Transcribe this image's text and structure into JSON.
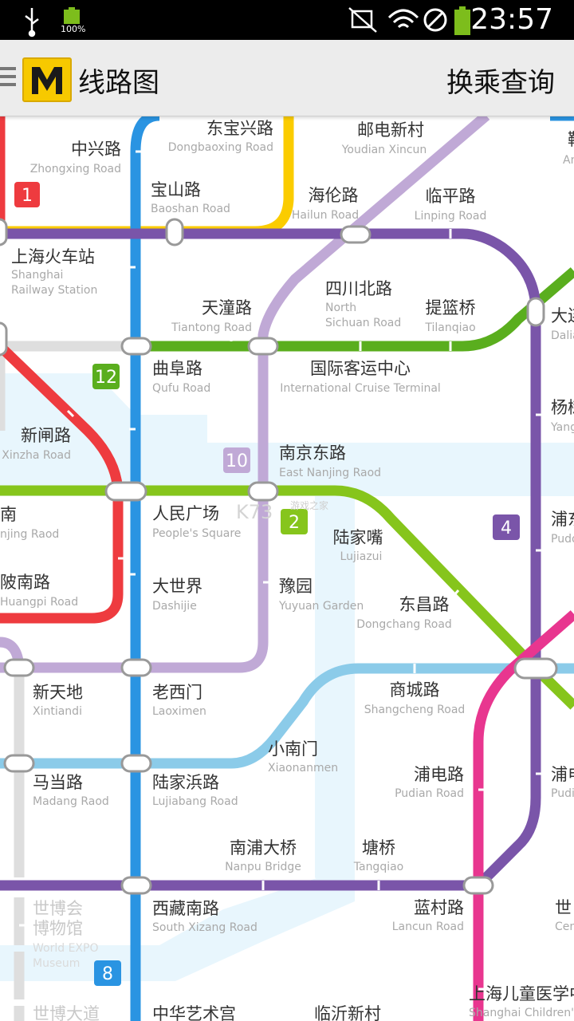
{
  "status_bar": {
    "battery": "100%",
    "time": "23:57"
  },
  "app_bar": {
    "title": "线路图",
    "transfer_action": "换乘查询"
  },
  "watermark": {
    "text": "K73",
    "sub": "游戏之家"
  },
  "map": {
    "line_colors": {
      "line1": "#ee3b3f",
      "line2": "#86c51c",
      "line3": "#fbcc00",
      "line4": "#7a55a9",
      "line8": "#2a94e2",
      "line9": "#8bcbe9",
      "line10": "#c0a9d6",
      "line12": "#5aae1e",
      "line13": "#e8368f",
      "line_gray": "#dedede",
      "river": "#e8f6fd"
    },
    "line_badges": [
      {
        "id": "1",
        "label": "1",
        "color": "#ee3b3f"
      },
      {
        "id": "12",
        "label": "12",
        "color": "#5aae1e"
      },
      {
        "id": "10",
        "label": "10",
        "color": "#c0a9d6"
      },
      {
        "id": "2",
        "label": "2",
        "color": "#86c51c"
      },
      {
        "id": "4",
        "label": "4",
        "color": "#7a55a9"
      },
      {
        "id": "8",
        "label": "8",
        "color": "#2a94e2"
      }
    ],
    "stations": [
      {
        "id": "zhongxing",
        "zh": "中兴路",
        "en": "Zhongxing Road"
      },
      {
        "id": "dongbaoxing",
        "zh": "东宝兴路",
        "en": "Dongbaoxing Road"
      },
      {
        "id": "youdian",
        "zh": "邮电新村",
        "en": "Youdian Xincun"
      },
      {
        "id": "baoshan",
        "zh": "宝山路",
        "en": "Baoshan Road"
      },
      {
        "id": "hailun",
        "zh": "海伦路",
        "en": "Hailun Road"
      },
      {
        "id": "linping",
        "zh": "临平路",
        "en": "Linping Road"
      },
      {
        "id": "shanghai_rs",
        "zh": "上海火车站",
        "en": "Shanghai",
        "en2": "Railway Station"
      },
      {
        "id": "sichuanbei",
        "zh": "四川北路",
        "en": "North",
        "en2": "Sichuan Road"
      },
      {
        "id": "tiantong",
        "zh": "天潼路",
        "en": "Tiantong Road"
      },
      {
        "id": "tilanqiao",
        "zh": "提篮桥",
        "en": "Tilanqiao"
      },
      {
        "id": "dalian",
        "zh": "大连",
        "en": "Dalia"
      },
      {
        "id": "qufu",
        "zh": "曲阜路",
        "en": "Qufu Road"
      },
      {
        "id": "cruise",
        "zh": "国际客运中心",
        "en": "International Cruise Terminal"
      },
      {
        "id": "yang",
        "zh": "杨树",
        "en": "Yang"
      },
      {
        "id": "xinzha",
        "zh": "新闸路",
        "en": "Xinzha Road"
      },
      {
        "id": "nanjingdong",
        "zh": "南京东路",
        "en": "East Nanjing Raod"
      },
      {
        "id": "nanjingxi",
        "zh": "南",
        "en": "njing Raod"
      },
      {
        "id": "peoples",
        "zh": "人民广场",
        "en": "People's Square"
      },
      {
        "id": "pudong",
        "zh": "浦东",
        "en": "Pudo"
      },
      {
        "id": "lujiazui",
        "zh": "陆家嘴",
        "en": "Lujiazui"
      },
      {
        "id": "huangpi",
        "zh": "陂南路",
        "en": "Huangpi Road"
      },
      {
        "id": "dashijie",
        "zh": "大世界",
        "en": "Dashijie"
      },
      {
        "id": "yuyuan",
        "zh": "豫园",
        "en": "Yuyuan Garden"
      },
      {
        "id": "dongchang",
        "zh": "东昌路",
        "en": "Dongchang Road"
      },
      {
        "id": "xintiandi",
        "zh": "新天地",
        "en": "Xintiandi"
      },
      {
        "id": "laoximen",
        "zh": "老西门",
        "en": "Laoximen"
      },
      {
        "id": "shangcheng",
        "zh": "商城路",
        "en": "Shangcheng Road"
      },
      {
        "id": "xiaonanmen",
        "zh": "小南门",
        "en": "Xiaonanmen"
      },
      {
        "id": "madang",
        "zh": "马当路",
        "en": "Madang Raod"
      },
      {
        "id": "lujiabang",
        "zh": "陆家浜路",
        "en": "Lujiabang Road"
      },
      {
        "id": "pudian",
        "zh": "浦电路",
        "en": "Pudian Road"
      },
      {
        "id": "pudian_r",
        "zh": "浦电",
        "en": "Pudi"
      },
      {
        "id": "nanpu",
        "zh": "南浦大桥",
        "en": "Nanpu Bridge"
      },
      {
        "id": "tangqiao",
        "zh": "塘桥",
        "en": "Tangqiao"
      },
      {
        "id": "expo",
        "zh": "世博会",
        "zh2": "博物馆",
        "en": "World EXPO",
        "en2": "Museum"
      },
      {
        "id": "xizangnan",
        "zh": "西藏南路",
        "en": "South Xizang Road"
      },
      {
        "id": "lancun",
        "zh": "蓝村路",
        "en": "Lancun Road"
      },
      {
        "id": "century",
        "zh": "世",
        "en": "Cen"
      },
      {
        "id": "children",
        "zh": "上海儿童医学中",
        "en": "Shanghai Children's"
      },
      {
        "id": "expo_ave",
        "zh": "世博大道",
        "en": ""
      },
      {
        "id": "art",
        "zh": "中华艺术宫",
        "en": ""
      },
      {
        "id": "linyi",
        "zh": "临沂新村",
        "en": ""
      },
      {
        "id": "top_right",
        "zh": "鞍",
        "en": "An"
      }
    ]
  }
}
